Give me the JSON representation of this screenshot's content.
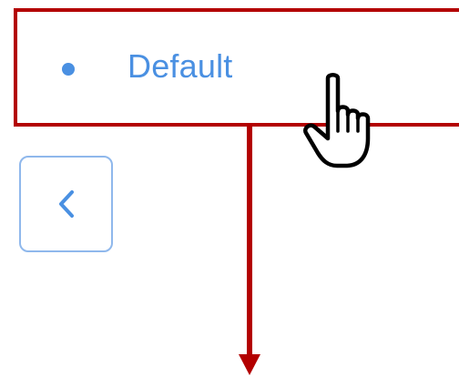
{
  "menu": {
    "items": [
      {
        "label": "Default",
        "bullet_icon": "dot-icon",
        "state": "hovered"
      }
    ]
  },
  "navigation": {
    "back_icon": "chevron-left-icon"
  },
  "annotations": {
    "highlight_color": "#b30000",
    "arrow_direction": "down",
    "cursor_icon": "hand-pointer-icon"
  },
  "colors": {
    "accent": "#4a90e2",
    "button_border": "#8fb8ec",
    "annotation": "#b30000"
  }
}
